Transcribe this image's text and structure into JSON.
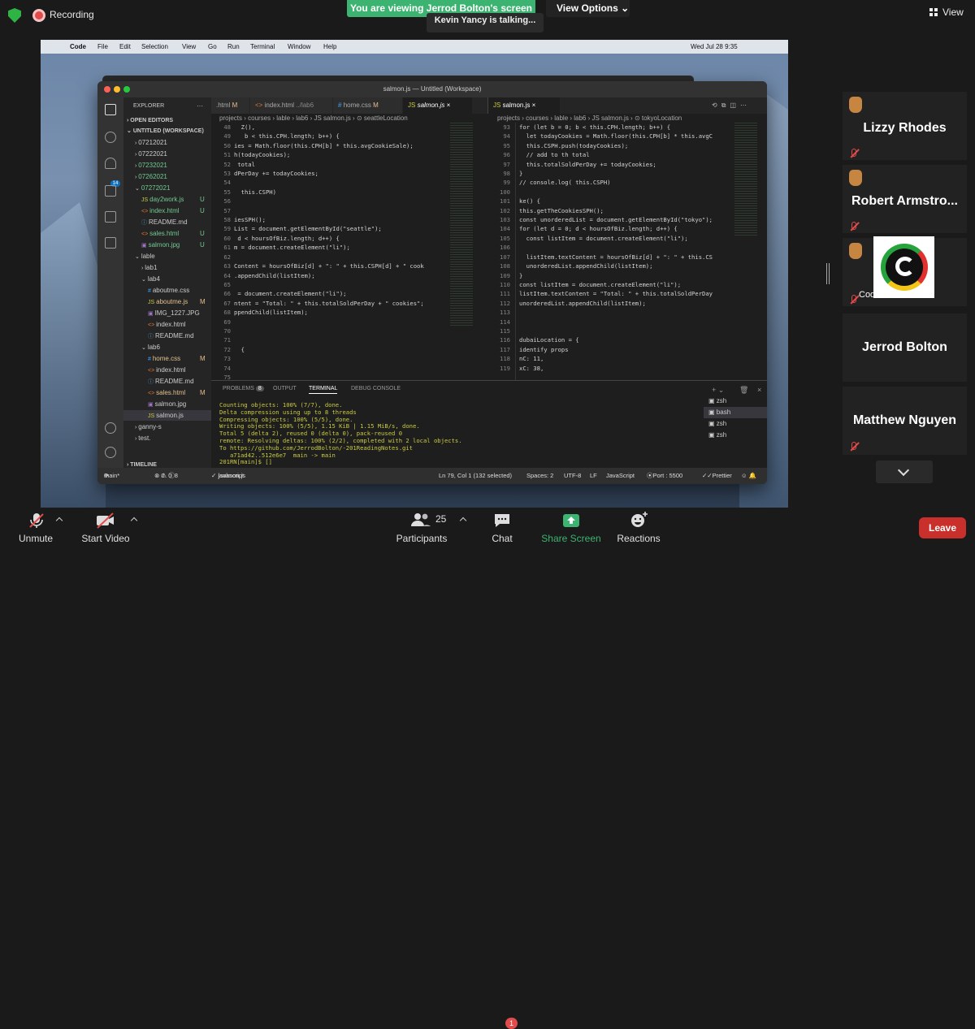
{
  "zoom": {
    "recording_label": "Recording",
    "viewing_banner": "You are viewing Jerrod Bolton's screen",
    "view_options_label": "View Options",
    "talking_label": "Kevin Yancy is talking...",
    "view_button_label": "View",
    "gallery": [
      {
        "name": "Lizzy Rhodes",
        "hand_raised": true,
        "muted": true
      },
      {
        "name": "Robert  Armstro...",
        "hand_raised": true,
        "muted": true
      },
      {
        "caption": "CodeCrew Te...",
        "hand_raised": true,
        "muted": true,
        "has_logo": true
      },
      {
        "name": "Jerrod Bolton",
        "hand_raised": false,
        "muted": false
      },
      {
        "name": "Matthew Nguyen",
        "hand_raised": false,
        "muted": true
      }
    ],
    "toolbar": {
      "unmute_label": "Unmute",
      "start_video_label": "Start Video",
      "participants_label": "Participants",
      "participants_count": "25",
      "chat_label": "Chat",
      "chat_badge": "1",
      "share_screen_label": "Share Screen",
      "reactions_label": "Reactions",
      "leave_label": "Leave"
    },
    "colors": {
      "accent_green": "#3cb371",
      "leave_red": "#c9302c"
    }
  },
  "mac": {
    "menu": [
      "Code",
      "File",
      "Edit",
      "Selection",
      "View",
      "Go",
      "Run",
      "Terminal",
      "Window",
      "Help"
    ],
    "clock": "Wed Jul 28  9:35"
  },
  "vscode": {
    "window_title": "salmon.js — Untitled (Workspace)",
    "explorer_title": "EXPLORER",
    "open_editors": "OPEN EDITORS",
    "workspace": "UNTITLED (WORKSPACE)",
    "tree": [
      {
        "label": "07212021",
        "indent": 1,
        "kind": "folder",
        "status": ""
      },
      {
        "label": "07222021",
        "indent": 1,
        "kind": "folder",
        "status": ""
      },
      {
        "label": "07232021",
        "indent": 1,
        "kind": "folder-u",
        "status": ""
      },
      {
        "label": "07262021",
        "indent": 1,
        "kind": "folder-u",
        "status": ""
      },
      {
        "label": "07272021",
        "indent": 1,
        "kind": "folder-u-open",
        "status": ""
      },
      {
        "label": "day2work.js",
        "indent": 2,
        "kind": "js",
        "status": "U"
      },
      {
        "label": "index.html",
        "indent": 2,
        "kind": "html",
        "status": "U"
      },
      {
        "label": "README.md",
        "indent": 2,
        "kind": "md",
        "status": ""
      },
      {
        "label": "sales.html",
        "indent": 2,
        "kind": "html",
        "status": "U"
      },
      {
        "label": "salmon.jpg",
        "indent": 2,
        "kind": "img",
        "status": "U"
      },
      {
        "label": "lable",
        "indent": 1,
        "kind": "folder-open",
        "status": ""
      },
      {
        "label": "lab1",
        "indent": 2,
        "kind": "folder",
        "status": ""
      },
      {
        "label": "lab4",
        "indent": 2,
        "kind": "folder-open",
        "status": ""
      },
      {
        "label": "aboutme.css",
        "indent": 3,
        "kind": "css",
        "status": ""
      },
      {
        "label": "aboutme.js",
        "indent": 3,
        "kind": "js",
        "status": "M"
      },
      {
        "label": "IMG_1227.JPG",
        "indent": 3,
        "kind": "img",
        "status": ""
      },
      {
        "label": "index.html",
        "indent": 3,
        "kind": "html",
        "status": ""
      },
      {
        "label": "README.md",
        "indent": 3,
        "kind": "md",
        "status": ""
      },
      {
        "label": "lab6",
        "indent": 2,
        "kind": "folder-open",
        "status": ""
      },
      {
        "label": "home.css",
        "indent": 3,
        "kind": "css",
        "status": "M"
      },
      {
        "label": "index.html",
        "indent": 3,
        "kind": "html",
        "status": ""
      },
      {
        "label": "README.md",
        "indent": 3,
        "kind": "md",
        "status": ""
      },
      {
        "label": "sales.html",
        "indent": 3,
        "kind": "html",
        "status": "M"
      },
      {
        "label": "salmon.jpg",
        "indent": 3,
        "kind": "img",
        "status": ""
      },
      {
        "label": "salmon.js",
        "indent": 3,
        "kind": "js",
        "status": "",
        "selected": true
      },
      {
        "label": "ganny-s",
        "indent": 1,
        "kind": "folder",
        "status": ""
      },
      {
        "label": "test.",
        "indent": 1,
        "kind": "folder",
        "status": ""
      }
    ],
    "timeline": "TIMELINE",
    "tabs_left": [
      {
        "label": ".html",
        "status": "M"
      },
      {
        "label": "index.html",
        "path": "../lab6",
        "status": ""
      },
      {
        "label": "home.css",
        "status": "M"
      },
      {
        "label": "salmon.js",
        "status": "",
        "active": true
      }
    ],
    "tab_right": {
      "label": "salmon.js",
      "active": true
    },
    "breadcrumb_left": "projects › courses › lable › lab6 › JS salmon.js › ⊙ seattleLocation",
    "breadcrumb_right": "projects › courses › lable › lab6 › JS salmon.js › ⊙ tokyoLocation",
    "left_lines": "48\n49\n50\n51\n52\n53\n54\n55\n56\n57\n58\n59\n60\n61\n62\n63\n64\n65\n66\n67\n68\n69\n70\n71\n72\n73\n74\n75",
    "left_code": "  Z(),\n   b < this.CPH.length; b++) {\nies = Math.floor(this.CPH[b] * this.avgCookieSale);\nh(todayCookies);\n total\ndPerDay += todayCookies;\n\n  this.CSPH)\n\n\niesSPH();\nList = document.getElementById(\"seattle\");\n d < hoursOfBiz.length; d++) {\nm = document.createElement(\"li\");\n\nContent = hoursOfBiz[d] + \": \" + this.CSPH[d] + \" cook\n.appendChild(listItem);\n\n = document.createElement(\"li\");\nntent = \"Total: \" + this.totalSoldPerDay + \" cookies\";\nppendChild(listItem);\n\n\n\n  {\n\n\n",
    "right_lines": "93\n94\n95\n96\n97\n98\n99\n100\n101\n102\n103\n104\n105\n106\n107\n108\n109\n110\n111\n112\n113\n114\n115\n116\n117\n118\n119",
    "right_code": "for (let b = 0; b < this.CPH.length; b++) {\n  let todayCookies = Math.floor(this.CPH[b] * this.avgC\n  this.CSPH.push(todayCookies);\n  // add to th total\n  this.totalSoldPerDay += todayCookies;\n}\n// console.log( this.CSPH)\n\nke() {\nthis.getTheCookiesSPH();\nconst unorderedList = document.getElementById(\"tokyo\");\nfor (let d = 0; d < hoursOfBiz.length; d++) {\n  const listItem = document.createElement(\"li\");\n\n  listItem.textContent = hoursOfBiz[d] + \": \" + this.CS\n  unorderedList.appendChild(listItem);\n}\nconst listItem = document.createElement(\"li\");\nlistItem.textContent = \"Total: \" + this.totalSoldPerDay\nunorderedList.appendChild(listItem);\n\n\n\ndubaiLocation = {\nidentify props\nnC: 11,\nxC: 38,",
    "panel_tabs": {
      "problems": "PROBLEMS",
      "problems_count": "8",
      "output": "OUTPUT",
      "terminal": "TERMINAL",
      "debug": "DEBUG CONSOLE"
    },
    "terminal_text": "Counting objects: 100% (7/7), done.\nDelta compression using up to 8 threads\nCompressing objects: 100% (5/5), done.\nWriting objects: 100% (5/5), 1.15 KiB | 1.15 MiB/s, done.\nTotal 5 (delta 2), reused 0 (delta 0), pack-reused 0\nremote: Resolving deltas: 100% (2/2), completed with 2 local objects.\nTo https://github.com/JerrodBolton/-201ReadingNotes.git\n   a71ad42..512e6e7  main -> main\n201RN[main]$ []",
    "shells": [
      "zsh",
      "bash",
      "zsh",
      "zsh"
    ],
    "status": {
      "branch": "main*",
      "errors": "0",
      "warnings": "0",
      "problems": "8",
      "language_left": "javascript",
      "file": "salmon.js",
      "position": "Ln 79, Col 1 (132 selected)",
      "spaces": "Spaces: 2",
      "encoding": "UTF-8",
      "eol": "LF",
      "language": "JavaScript",
      "port": "Port : 5500",
      "prettier": "Prettier"
    }
  }
}
